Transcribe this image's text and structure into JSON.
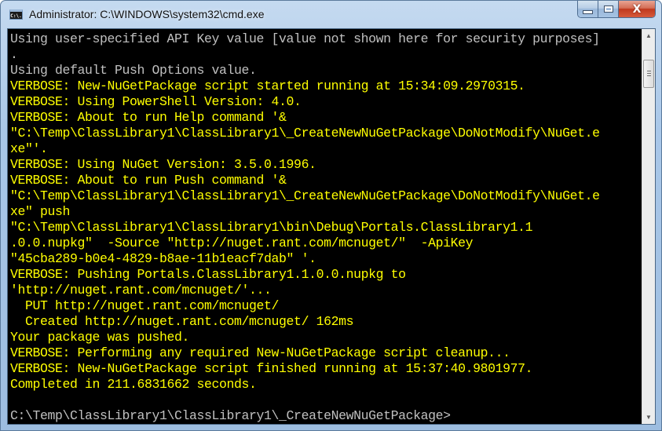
{
  "window": {
    "title": "Administrator: C:\\WINDOWS\\system32\\cmd.exe",
    "icon": "cmd-icon",
    "icon_text": "C:\\.",
    "buttons": {
      "minimize": "minimize-icon",
      "maximize": "maximize-icon",
      "close_glyph": "X"
    }
  },
  "colors": {
    "background": "#000000",
    "default_text": "#c0c0c0",
    "verbose_text": "#ffff00"
  },
  "console": {
    "lines": [
      {
        "text": "Using user-specified API Key value [value not shown here for security purposes]",
        "color": "gray"
      },
      {
        "text": ".",
        "color": "gray"
      },
      {
        "text": "Using default Push Options value.",
        "color": "gray"
      },
      {
        "text": "VERBOSE: New-NuGetPackage script started running at 15:34:09.2970315.",
        "color": "yellow"
      },
      {
        "text": "VERBOSE: Using PowerShell Version: 4.0.",
        "color": "yellow"
      },
      {
        "text": "VERBOSE: About to run Help command '&",
        "color": "yellow"
      },
      {
        "text": "\"C:\\Temp\\ClassLibrary1\\ClassLibrary1\\_CreateNewNuGetPackage\\DoNotModify\\NuGet.e",
        "color": "yellow"
      },
      {
        "text": "xe\"'.",
        "color": "yellow"
      },
      {
        "text": "VERBOSE: Using NuGet Version: 3.5.0.1996.",
        "color": "yellow"
      },
      {
        "text": "VERBOSE: About to run Push command '&",
        "color": "yellow"
      },
      {
        "text": "\"C:\\Temp\\ClassLibrary1\\ClassLibrary1\\_CreateNewNuGetPackage\\DoNotModify\\NuGet.e",
        "color": "yellow"
      },
      {
        "text": "xe\" push",
        "color": "yellow"
      },
      {
        "text": "\"C:\\Temp\\ClassLibrary1\\ClassLibrary1\\bin\\Debug\\Portals.ClassLibrary1.1",
        "color": "yellow"
      },
      {
        "text": ".0.0.nupkg\"  -Source \"http://nuget.rant.com/mcnuget/\"  -ApiKey",
        "color": "yellow"
      },
      {
        "text": "\"45cba289-b0e4-4829-b8ae-11b1eacf7dab\" '.",
        "color": "yellow"
      },
      {
        "text": "VERBOSE: Pushing Portals.ClassLibrary1.1.0.0.nupkg to",
        "color": "yellow"
      },
      {
        "text": "'http://nuget.rant.com/mcnuget/'...",
        "color": "yellow"
      },
      {
        "text": "  PUT http://nuget.rant.com/mcnuget/",
        "color": "yellow"
      },
      {
        "text": "  Created http://nuget.rant.com/mcnuget/ 162ms",
        "color": "yellow"
      },
      {
        "text": "Your package was pushed.",
        "color": "yellow"
      },
      {
        "text": "VERBOSE: Performing any required New-NuGetPackage script cleanup...",
        "color": "yellow"
      },
      {
        "text": "VERBOSE: New-NuGetPackage script finished running at 15:37:40.9801977.",
        "color": "yellow"
      },
      {
        "text": "Completed in 211.6831662 seconds.",
        "color": "yellow"
      },
      {
        "text": "",
        "color": "yellow"
      },
      {
        "text": "C:\\Temp\\ClassLibrary1\\ClassLibrary1\\_CreateNewNuGetPackage>",
        "color": "gray"
      }
    ]
  },
  "scrollbar": {
    "up_arrow": "▲",
    "down_arrow": "▼",
    "position_fraction": 0.05
  }
}
